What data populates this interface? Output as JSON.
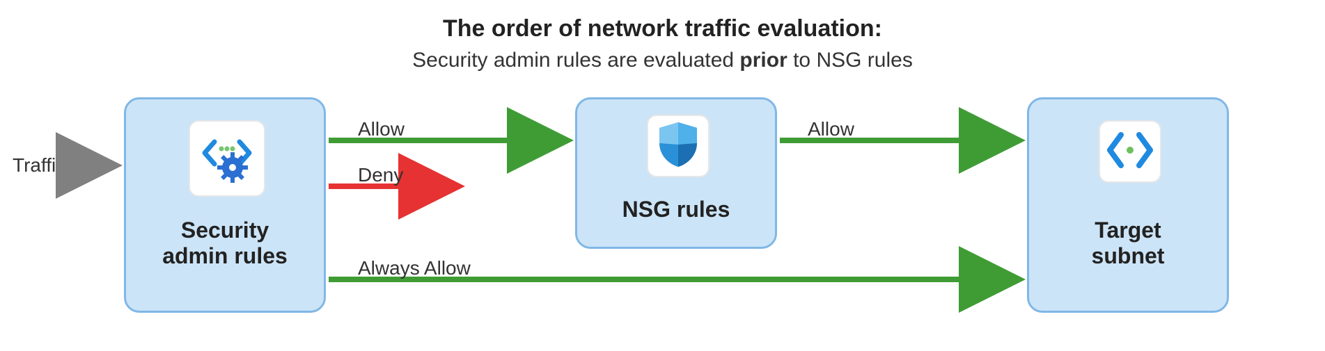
{
  "title": "The order of network traffic evaluation:",
  "subtitle_prefix": "Security admin rules are evaluated ",
  "subtitle_bold": "prior",
  "subtitle_suffix": " to NSG rules",
  "traffic_label": "Traffic",
  "nodes": {
    "security": {
      "label_line1": "Security",
      "label_line2": "admin rules",
      "icon": "security-admin-icon"
    },
    "nsg": {
      "label": "NSG rules",
      "icon": "shield-icon"
    },
    "target": {
      "label_line1": "Target",
      "label_line2": "subnet",
      "icon": "subnet-icon"
    }
  },
  "edges": {
    "allow1": {
      "label": "Allow",
      "color": "#3f9c35"
    },
    "deny": {
      "label": "Deny",
      "color": "#e63232"
    },
    "allow2": {
      "label": "Allow",
      "color": "#3f9c35"
    },
    "always_allow": {
      "label": "Always Allow",
      "color": "#3f9c35"
    },
    "traffic": {
      "color": "#808080"
    }
  },
  "colors": {
    "box_fill": "#cce4f7",
    "box_stroke": "#80b7e6",
    "green": "#3f9c35",
    "red": "#e63232",
    "grey": "#808080"
  }
}
